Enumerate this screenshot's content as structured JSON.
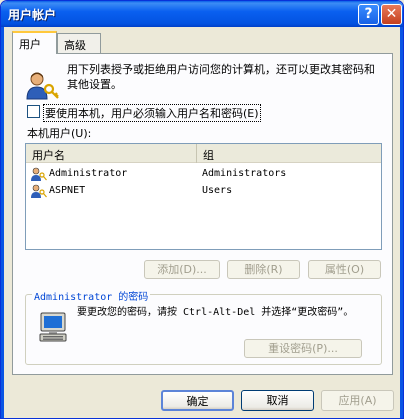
{
  "window": {
    "title": "用户帐户",
    "help_label": "?",
    "close_label": "✕"
  },
  "tabs": [
    {
      "label": "用户",
      "selected": true
    },
    {
      "label": "高级",
      "selected": false
    }
  ],
  "intro": {
    "text": "用下列表授予或拒绝用户访问您的计算机，还可以更改其密码和其他设置。",
    "icon": "users-keys-icon"
  },
  "require_login": {
    "label": "要使用本机，用户必须输入用户名和密码(E)",
    "checked": false
  },
  "users_list": {
    "label": "本机用户(U):",
    "columns": [
      "用户名",
      "组"
    ],
    "rows": [
      {
        "name": "Administrator",
        "group": "Administrators"
      },
      {
        "name": "ASPNET",
        "group": "Users"
      }
    ]
  },
  "list_buttons": {
    "add": "添加(D)...",
    "delete": "删除(R)",
    "properties": "属性(O)"
  },
  "password_group": {
    "title": "Administrator 的密码",
    "text": "要更改您的密码，请按 Ctrl-Alt-Del 并选择“更改密码”。",
    "reset_button": "重设密码(P)..."
  },
  "dialog_buttons": {
    "ok": "确定",
    "cancel": "取消",
    "apply": "应用(A)"
  },
  "colors": {
    "titlebar": "#0a5fe8",
    "dialog_bg": "#ece9d8",
    "group_title": "#0046d5"
  }
}
